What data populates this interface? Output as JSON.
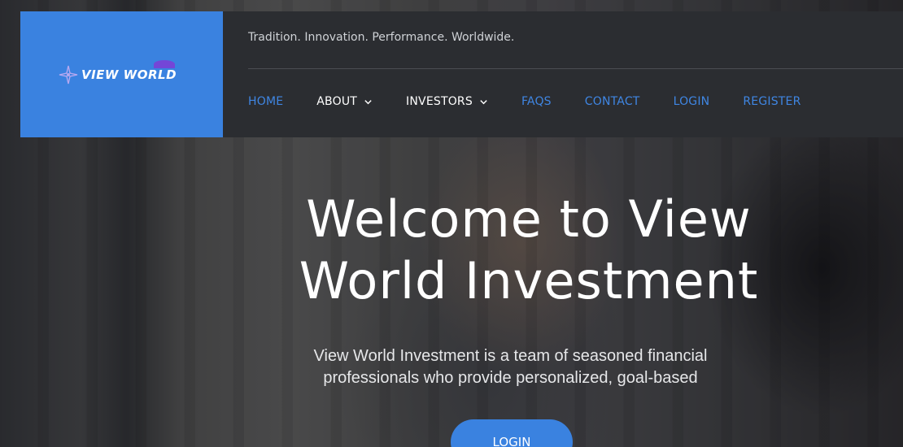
{
  "brand": {
    "logo_text": "VIEW WORLD",
    "logo_bg": "#3a82e0",
    "accent": "#7b3fd6",
    "icon": "compass-star-icon"
  },
  "header": {
    "tagline": "Tradition. Innovation. Performance. Worldwide.",
    "bg": "#2b2d31"
  },
  "nav": {
    "link_color": "#3f86e3",
    "items": [
      {
        "label": "HOME"
      },
      {
        "label": "ABOUT",
        "dropdown": true,
        "icon": "chevron-down-icon"
      },
      {
        "label": "INVESTORS",
        "dropdown": true,
        "icon": "chevron-down-icon"
      },
      {
        "label": "FAQS"
      },
      {
        "label": "CONTACT"
      },
      {
        "label": "LOGIN"
      },
      {
        "label": "REGISTER"
      }
    ]
  },
  "hero": {
    "headline_line1": "Welcome to View",
    "headline_line2": "World Investment",
    "subtext": "View World Investment is a team of seasoned financial professionals who provide personalized, goal-based",
    "cta_label": "LOGIN",
    "cta_color": "#3a82e0"
  }
}
